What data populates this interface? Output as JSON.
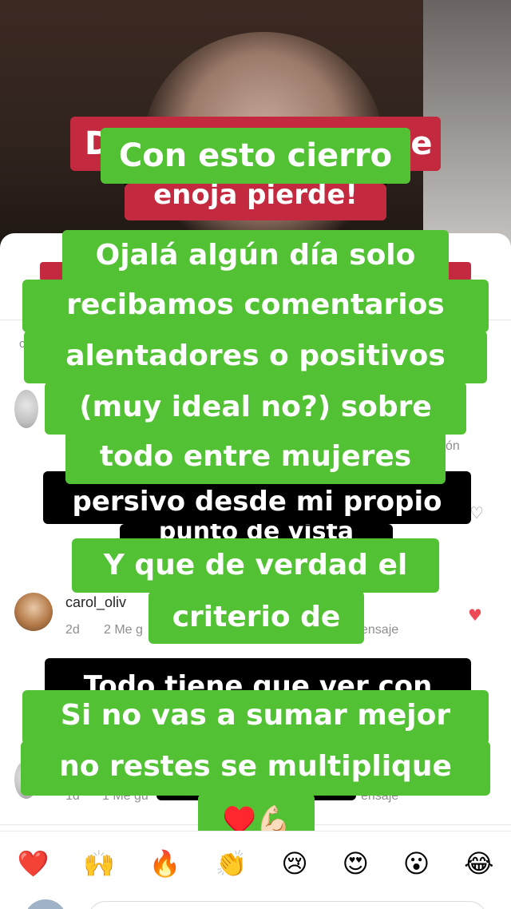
{
  "background": {
    "red_top_left": "D",
    "red_top_right": "e",
    "red_second": "enoja pierde!"
  },
  "comments": {
    "partial_user": "c",
    "right_stub": "ón",
    "black_line_1": "persivo desde mi propio",
    "black_line_2": "punto de vista",
    "black_line_3": "Todo tiene que ver con",
    "item": {
      "username": "carol_oliv",
      "age": "2d",
      "likes": "2 Me g",
      "reply_stub": "ensaje"
    },
    "item2": {
      "age": "1d",
      "likes": "1 Me gu",
      "reply_stub": "ensaje"
    }
  },
  "story": {
    "box1": "Con esto cierro",
    "box2_lines": [
      "Ojalá algún día solo",
      "recibamos comentarios",
      "alentadores o positivos",
      "(muy ideal no?)  sobre",
      "todo entre mujeres"
    ],
    "box3": "Y que de verdad el",
    "box4": "criterio de",
    "box5_lines": [
      "Si no vas a sumar mejor",
      "no restes se multiplique"
    ],
    "box6": "♥️💪🏻"
  },
  "reactions": [
    "❤️",
    "🙌",
    "🔥",
    "👏",
    "😢",
    "😍",
    "😮",
    "😂"
  ],
  "colors": {
    "story_green": "#52c234",
    "story_red": "#c3293f",
    "like_red": "#ed4956"
  }
}
